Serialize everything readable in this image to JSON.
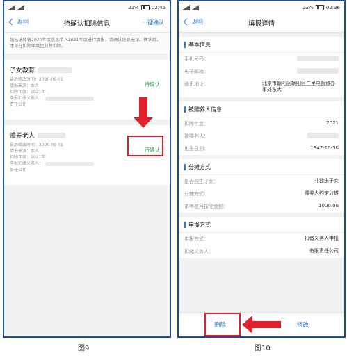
{
  "left": {
    "status": {
      "battery_percent": "21%",
      "time": "02:45"
    },
    "nav": {
      "back": "返回",
      "title": "待确认扣除信息",
      "action": "一键确认"
    },
    "notice": "您已选择将2020年度信息带入2021年度进行填报，请确认信息无误。确认后，才可在扣除年度生效并扣除。",
    "cards": [
      {
        "title": "子女教育",
        "meta": [
          "最后修改时间：2020-09-01",
          "填报来源：本人",
          "扣除年度：2021年",
          "申报扣缴义务人：",
          "责任公司"
        ],
        "status": "待确认"
      },
      {
        "title": "赡养老人",
        "meta": [
          "最后修改时间：2020-09-01",
          "填报来源：本人",
          "扣除年度：2021年",
          "申报扣缴义务人：",
          "责任公司"
        ],
        "status": "待确认"
      }
    ],
    "caption": "图9"
  },
  "right": {
    "status": {
      "battery_percent": "22%",
      "time": "02:36"
    },
    "nav": {
      "back": "返回",
      "title": "填报详情"
    },
    "sections": [
      {
        "title": "基本信息",
        "rows": [
          {
            "label": "手机号码：",
            "value": ""
          },
          {
            "label": "电子邮箱：",
            "value": ""
          },
          {
            "label": "通讯地址：",
            "value": "北京市朝阳区朝阳区三里屯街道办事处东大"
          }
        ]
      },
      {
        "title": "被赡养人信息",
        "rows": [
          {
            "label": "扣除年度：",
            "value": "2021"
          },
          {
            "label": "被赡养人：",
            "value": ""
          },
          {
            "label": "出生日期：",
            "value": "1947-10-30"
          }
        ]
      },
      {
        "title": "分摊方式",
        "rows": [
          {
            "label": "是否独生子女：",
            "value": "非独生子女"
          },
          {
            "label": "分摊方式：",
            "value": "赡养人约定分摊"
          },
          {
            "label": "本年度月扣除金额：",
            "value": "1000.00"
          }
        ]
      },
      {
        "title": "申报方式",
        "rows": [
          {
            "label": "申报方式：",
            "value": "扣缴义务人申报"
          },
          {
            "label": "扣缴义务人：",
            "value": "有限责任公司"
          }
        ]
      }
    ],
    "buttons": {
      "delete": "删除",
      "edit": "修改"
    },
    "caption": "图10"
  },
  "colors": {
    "accent": "#2a7bd4",
    "confirm_green": "#3a9b55",
    "highlight_red": "#e0202a",
    "frame_blue": "#1f4d8f"
  }
}
